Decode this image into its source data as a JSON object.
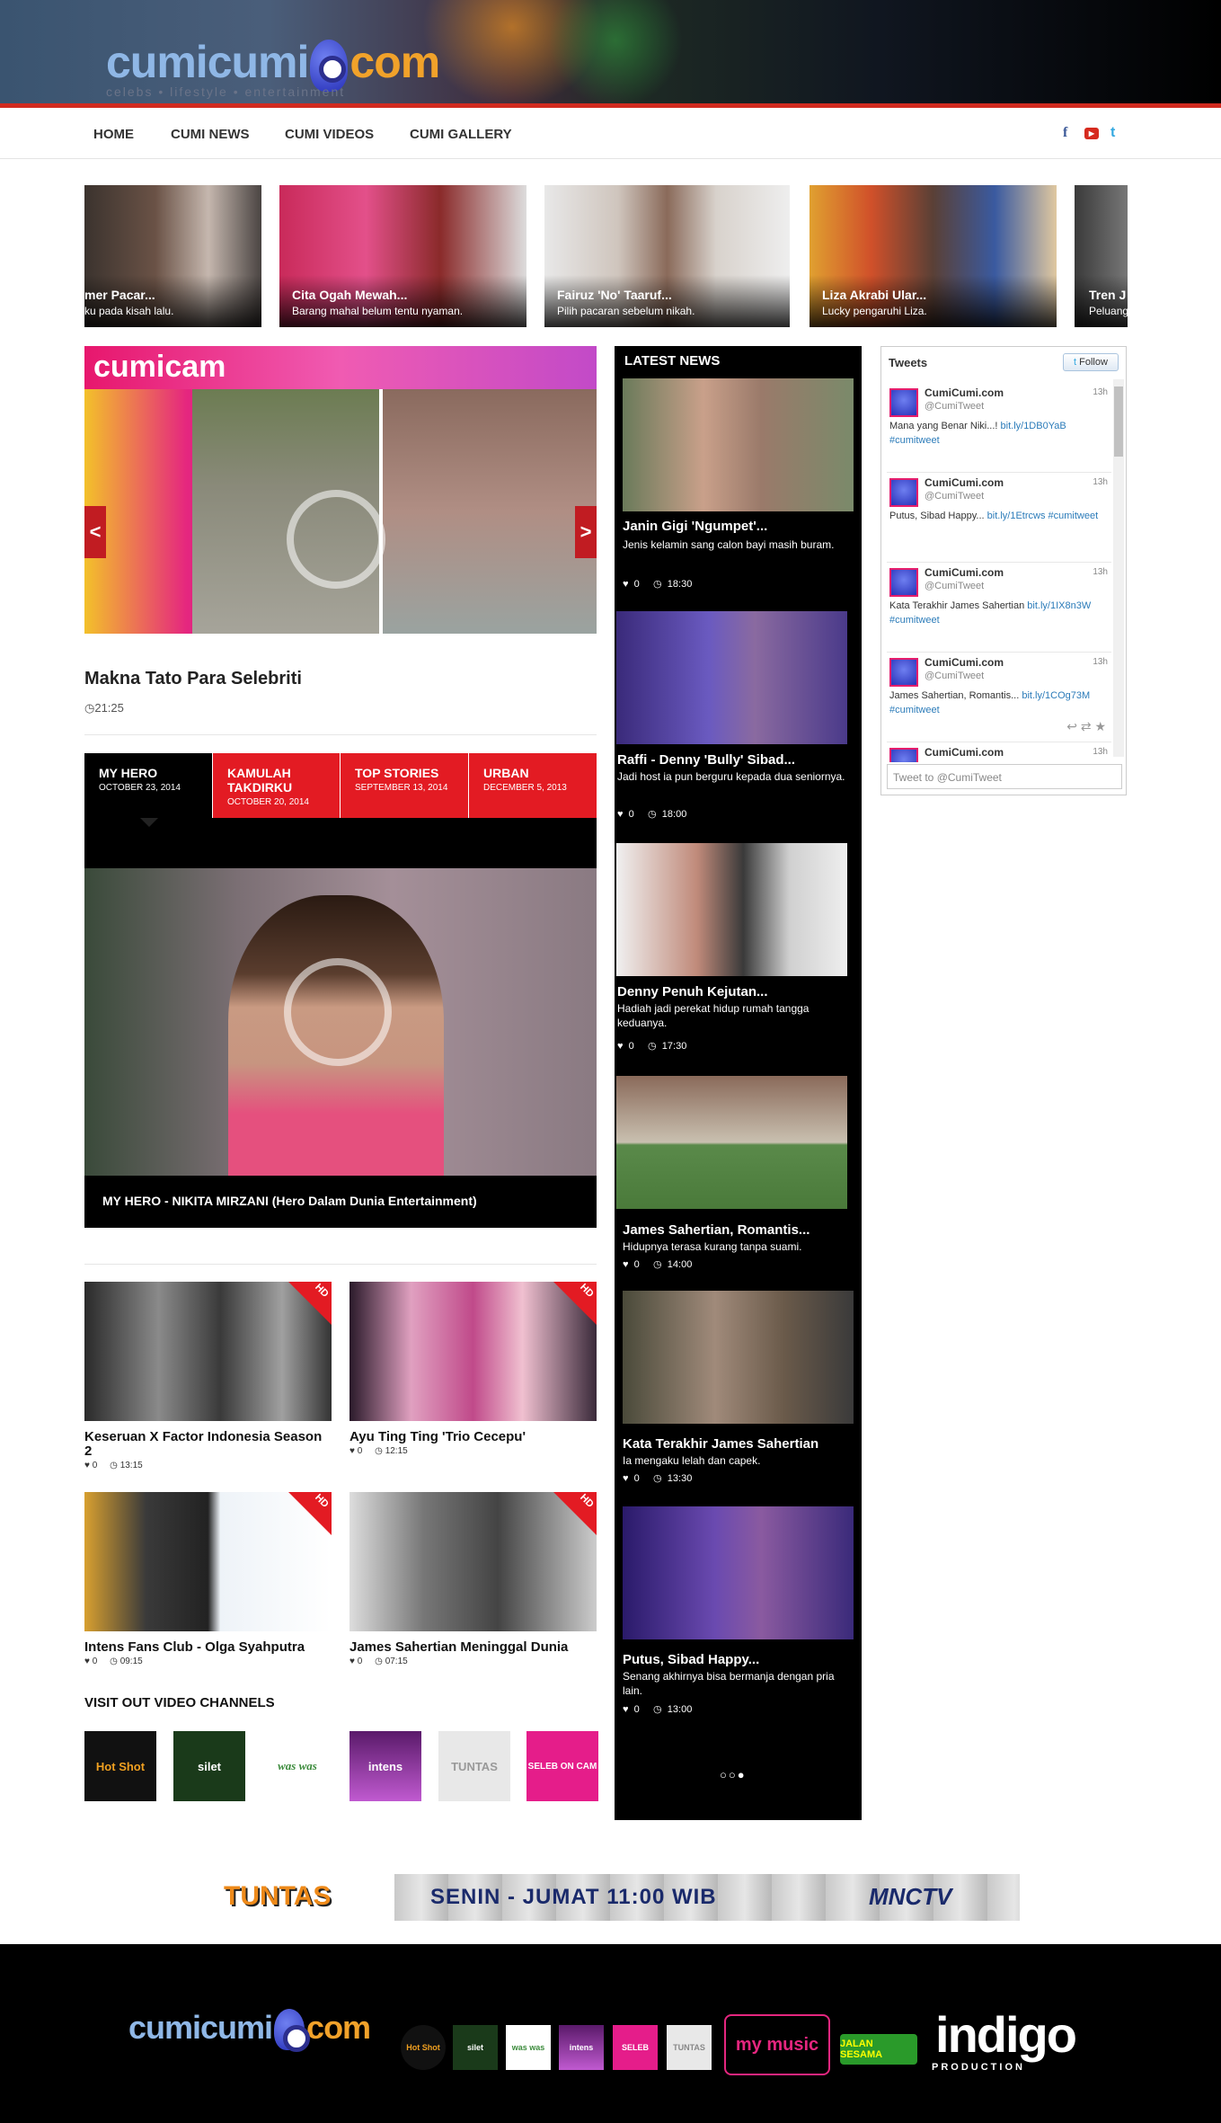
{
  "header": {
    "logo_a": "cumicumi",
    "logo_b": "com",
    "tagline": "celebs • lifestyle • entertainment"
  },
  "nav": {
    "items": [
      "HOME",
      "CUMI NEWS",
      "CUMI VIDEOS",
      "CUMI GALLERY"
    ],
    "social": [
      "f",
      "▶",
      "t"
    ]
  },
  "top_slider": [
    {
      "title": "mer Pacar...",
      "sub": "ku pada kisah lalu."
    },
    {
      "title": "Cita Ogah Mewah...",
      "sub": "Barang mahal belum tentu nyaman."
    },
    {
      "title": "Fairuz 'No' Taaruf...",
      "sub": "Pilih pacaran sebelum nikah."
    },
    {
      "title": "Liza Akrabi Ular...",
      "sub": "Lucky pengaruhi Liza."
    },
    {
      "title": "Tren J",
      "sub": "Peluang"
    }
  ],
  "cumicam": {
    "label": "cumicam",
    "title": "Makna Tato Para Selebriti",
    "time": "21:25",
    "prev": "<",
    "next": ">"
  },
  "tabs": [
    {
      "name": "MY HERO",
      "date": "OCTOBER 23, 2014"
    },
    {
      "name": "KAMULAH TAKDIRKU",
      "date": "OCTOBER 20, 2014"
    },
    {
      "name": "TOP STORIES",
      "date": "SEPTEMBER 13, 2014"
    },
    {
      "name": "URBAN",
      "date": "DECEMBER 5, 2013"
    }
  ],
  "tab_caption": "MY HERO - NIKITA MIRZANI (Hero Dalam Dunia Entertainment)",
  "videos": [
    {
      "title": "Keseruan X Factor Indonesia Season 2",
      "likes": "0",
      "time": "13:15",
      "badge": "HD"
    },
    {
      "title": "Ayu Ting Ting 'Trio Cecepu'",
      "likes": "0",
      "time": "12:15",
      "badge": "HD"
    },
    {
      "title": "Intens Fans Club - Olga Syahputra",
      "likes": "0",
      "time": "09:15",
      "badge": "HD"
    },
    {
      "title": "James Sahertian Meninggal Dunia",
      "likes": "0",
      "time": "07:15",
      "badge": "HD"
    }
  ],
  "channels": {
    "title": "VISIT OUT VIDEO CHANNELS",
    "items": [
      "Hot Shot",
      "silet",
      "was was",
      "intens",
      "TUNTAS",
      "SELEB ON CAM"
    ]
  },
  "latest": {
    "title": "LATEST NEWS",
    "items": [
      {
        "title": "Janin Gigi 'Ngumpet'...",
        "sub": "Jenis kelamin sang calon bayi masih buram.",
        "likes": "0",
        "time": "18:30"
      },
      {
        "title": "Raffi - Denny 'Bully' Sibad...",
        "sub": "Jadi host ia pun berguru kepada dua seniornya.",
        "likes": "0",
        "time": "18:00"
      },
      {
        "title": "Denny Penuh Kejutan...",
        "sub": "Hadiah jadi perekat hidup rumah tangga keduanya.",
        "likes": "0",
        "time": "17:30"
      },
      {
        "title": "James Sahertian, Romantis...",
        "sub": "Hidupnya terasa kurang tanpa suami.",
        "likes": "0",
        "time": "14:00"
      },
      {
        "title": "Kata Terakhir James Sahertian",
        "sub": "Ia mengaku lelah dan capek.",
        "likes": "0",
        "time": "13:30"
      },
      {
        "title": "Putus, Sibad Happy...",
        "sub": "Senang akhirnya bisa bermanja dengan pria lain.",
        "likes": "0",
        "time": "13:00"
      }
    ],
    "dots": "○○●"
  },
  "tweets": {
    "title": "Tweets",
    "follow": "Follow",
    "placeholder": "Tweet to @CumiTweet",
    "items": [
      {
        "name": "CumiCumi.com",
        "handle": "@CumiTweet",
        "time": "13h",
        "text": "Mana yang Benar Niki...!",
        "link": "bit.ly/1DB0YaB",
        "tag": "#cumitweet"
      },
      {
        "name": "CumiCumi.com",
        "handle": "@CumiTweet",
        "time": "13h",
        "text": "Putus, Sibad Happy...",
        "link": "bit.ly/1Etrcws",
        "tag": "#cumitweet"
      },
      {
        "name": "CumiCumi.com",
        "handle": "@CumiTweet",
        "time": "13h",
        "text": "Kata Terakhir James Sahertian",
        "link": "bit.ly/1IX8n3W",
        "tag": "#cumitweet"
      },
      {
        "name": "CumiCumi.com",
        "handle": "@CumiTweet",
        "time": "13h",
        "text": "James Sahertian, Romantis...",
        "link": "bit.ly/1COg73M",
        "tag": "#cumitweet"
      },
      {
        "name": "CumiCumi.com",
        "handle": "",
        "time": "13h",
        "text": "",
        "link": "",
        "tag": ""
      }
    ]
  },
  "banner": {
    "left": "TUNTAS",
    "middle": "SENIN - JUMAT 11:00 WIB",
    "right": "MNCTV"
  },
  "footer": {
    "logos": [
      "Hot Shot",
      "silet",
      "was was",
      "intens",
      "SELEB",
      "TUNTAS",
      "my music",
      "JALAN SESAMA",
      "indigo"
    ],
    "indigo_sub": "PRODUCTION"
  }
}
